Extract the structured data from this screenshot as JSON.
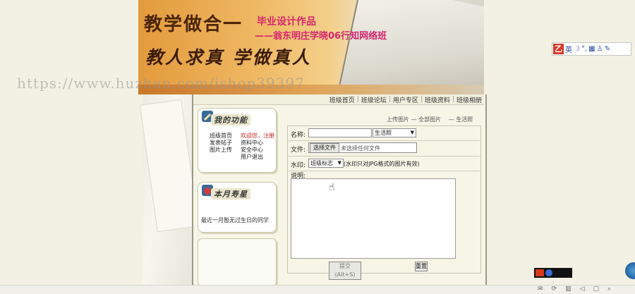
{
  "banner": {
    "calligraphy_line1": "教学做合一",
    "calligraphy_line2": "教人求真 学做真人",
    "subtitle1": "毕业设计作品",
    "subtitle2": "——翁东明庄学晓06行知网络班"
  },
  "watermark": "https://www.huzhan.com/ishop39397",
  "ime_bar": {
    "label": "英"
  },
  "top_nav": [
    "班级首页",
    "班级论坛",
    "用户专区",
    "班级资料",
    "班级相册"
  ],
  "panel_user": {
    "title": "我的功能",
    "links_left": [
      "班级首页",
      "发表帖子",
      "图片上传"
    ],
    "links_right": [
      "欢迎您，注册",
      "资料中心",
      "安全中心",
      "用户退出"
    ]
  },
  "panel_birthday": {
    "title": "本月寿星",
    "message": "最近一月暂无过生日的同学"
  },
  "breadcrumbs": [
    "上传图片",
    "全部图片",
    "生活照"
  ],
  "form": {
    "name_label": "名称:",
    "name_value": "",
    "category_selected": "生活照",
    "file_label": "文件:",
    "file_button": "选择文件",
    "file_status": "未选择任何文件",
    "watermark_label": "水印:",
    "watermark_selected": "班级标志",
    "watermark_note": "(水印只对JPG格式的图片有效)",
    "desc_label": "说明:",
    "desc_value": "",
    "submit_label": "提交(Alt+S)",
    "reset_label": "重置"
  }
}
